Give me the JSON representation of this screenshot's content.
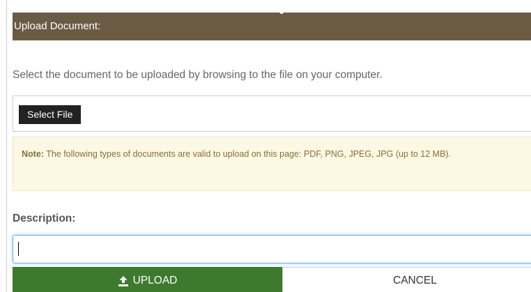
{
  "header": {
    "title": "Upload Document:"
  },
  "intro": {
    "text": "Select the document to be uploaded by browsing to the file on your computer."
  },
  "file_picker": {
    "button_label": "Select File"
  },
  "note": {
    "label": "Note:",
    "text": " The following types of documents are valid to upload on this page: PDF, PNG, JPEG, JPG (up to 12 MB)."
  },
  "description": {
    "label": "Description:",
    "value": "",
    "placeholder": ""
  },
  "actions": {
    "upload_label": "UPLOAD",
    "cancel_label": "CANCEL"
  },
  "icons": {
    "upload": "upload-icon"
  },
  "colors": {
    "header_bg": "#6b5b45",
    "upload_bg": "#3e7a2e",
    "note_bg": "#fcf8e3",
    "input_focus": "#66afe9"
  }
}
